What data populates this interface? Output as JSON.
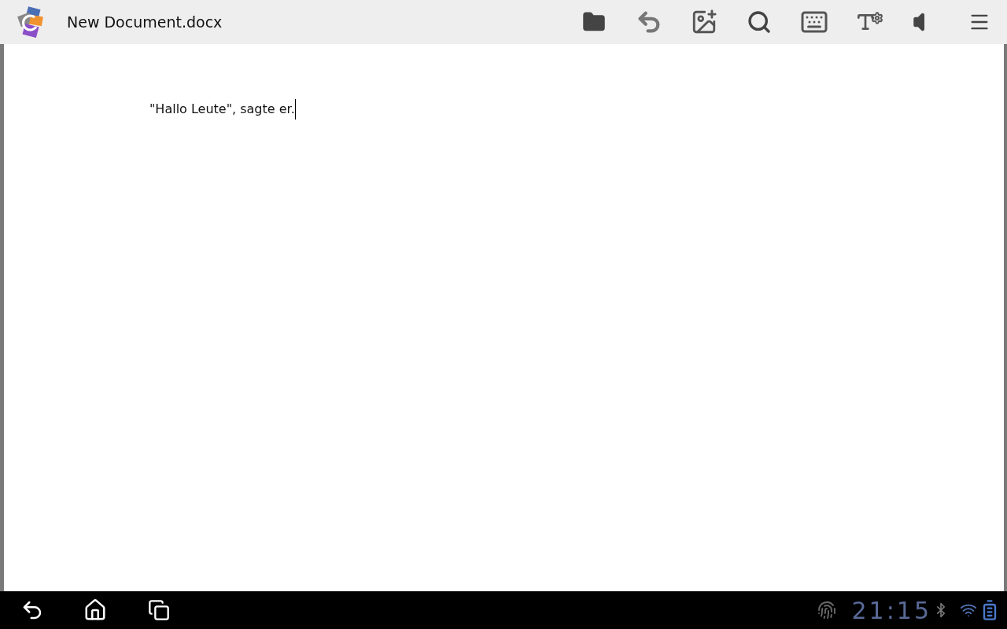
{
  "app_bar": {
    "title": "New Document.docx"
  },
  "document": {
    "paragraphs": [
      "\"Hallo Leute\", sagte er."
    ]
  },
  "status_bar": {
    "clock": "21:15"
  }
}
